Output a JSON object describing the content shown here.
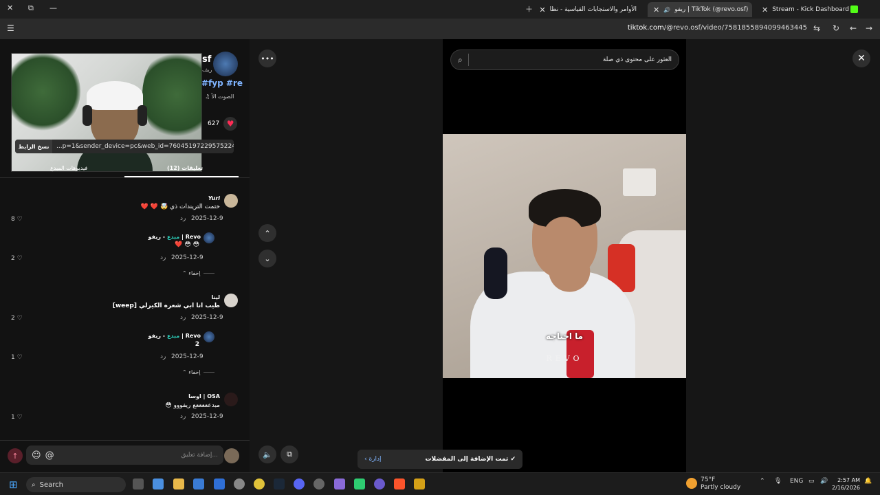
{
  "browser": {
    "tabs": [
      {
        "title": "Stream - Kick Dashboard",
        "active": false
      },
      {
        "title": "ريفو | TikTok (@revo.osf)",
        "active": true
      },
      {
        "title": "الأوامر والاستجابات القياسية - نظا",
        "active": false
      }
    ],
    "url_domain": "tiktok.com",
    "url_path": "/@revo.osf/video/7581855894099463445"
  },
  "author": {
    "name_fragment": "sf",
    "sub_fragment": "ريف",
    "tags": "#fyp #re",
    "sound": "الصوت الأ"
  },
  "likes": {
    "count": "627"
  },
  "share": {
    "copy_label": "نسخ الرابط",
    "link": "...p=1&sender_device=pc&web_id=7604519722957522439"
  },
  "tabs": {
    "comments": "تعليقات (12)",
    "creator_videos": "فيديوهات المبدع"
  },
  "comments": [
    {
      "name": "Yuri",
      "text": "ختمت التريندات ذي 🤯 ❤️ ❤️",
      "date": "2025-12-9",
      "reply": "رد",
      "likes": "8"
    },
    {
      "name": "ريفو | Revo",
      "creator": "مبدع",
      "text": "😳 😳 ❤️",
      "date": "2025-12-9",
      "reply": "رد",
      "likes": "2",
      "hide": "إخفاء"
    },
    {
      "name": "لينا",
      "text": "طيب انا ابي شعره الكيرلي [weep]",
      "date": "2025-12-9",
      "reply": "رد",
      "likes": "2"
    },
    {
      "name": "ريفو | Revo",
      "creator": "مبدع",
      "text": "2",
      "date": "2025-12-9",
      "reply": "رد",
      "likes": "1",
      "hide": "إخفاء"
    },
    {
      "name": "اوسا | OSA",
      "text": "مبدعععععع ريفووو 😳",
      "date": "2025-12-9",
      "reply": "رد",
      "likes": "1"
    }
  ],
  "composer": {
    "placeholder": "إضافة تعليق..."
  },
  "video": {
    "search_text": "العثور على محتوى ذي صلة",
    "subtitle": "ما احتاجه",
    "watermark": "REVO"
  },
  "toast": {
    "message": "تمت الإضافة إلى المفضلات",
    "manage": "إدارة"
  },
  "taskbar": {
    "search_label": "Search",
    "weather_temp": "75°F",
    "weather_desc": "Partly cloudy",
    "lang": "ENG",
    "time": "2:57 AM",
    "date": "2/16/2026"
  },
  "colors": {
    "accent_red": "#fe2c55",
    "creator_teal": "#2dd4bf",
    "link_blue": "#7fb4ff"
  }
}
